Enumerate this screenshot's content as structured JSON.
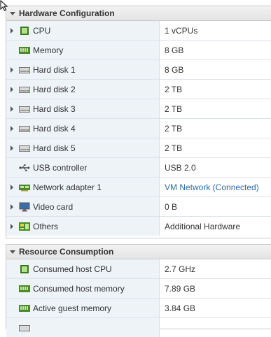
{
  "hardware": {
    "title": "Hardware Configuration",
    "rows": [
      {
        "label": "CPU",
        "value": "1 vCPUs",
        "icon": "cpu-icon"
      },
      {
        "label": "Memory",
        "value": "8 GB",
        "icon": "memory-icon"
      },
      {
        "label": "Hard disk 1",
        "value": "8 GB",
        "icon": "hard-disk-icon"
      },
      {
        "label": "Hard disk 2",
        "value": "2 TB",
        "icon": "hard-disk-icon"
      },
      {
        "label": "Hard disk 3",
        "value": "2 TB",
        "icon": "hard-disk-icon"
      },
      {
        "label": "Hard disk 4",
        "value": "2 TB",
        "icon": "hard-disk-icon"
      },
      {
        "label": "Hard disk 5",
        "value": "2 TB",
        "icon": "hard-disk-icon"
      },
      {
        "label": "USB controller",
        "value": "USB 2.0",
        "icon": "usb-icon"
      },
      {
        "label": "Network adapter 1",
        "value": "VM Network  (Connected)",
        "icon": "network-adapter-icon"
      },
      {
        "label": "Video card",
        "value": "0 B",
        "icon": "monitor-icon"
      },
      {
        "label": "Others",
        "value": "Additional Hardware",
        "icon": "others-icon"
      }
    ]
  },
  "resource": {
    "title": "Resource Consumption",
    "rows": [
      {
        "label": "Consumed host CPU",
        "value": "2.7 GHz",
        "icon": "cpu-icon"
      },
      {
        "label": "Consumed host memory",
        "value": "7.89 GB",
        "icon": "memory-icon"
      },
      {
        "label": "Active guest memory",
        "value": "3.84 GB",
        "icon": "memory-icon"
      },
      {
        "label": "",
        "value": "",
        "icon": "storage-icon"
      }
    ]
  },
  "colors": {
    "header_bg": "#e8e8e8",
    "name_cell_bg": "#eef3f8",
    "link": "#2b6aa8",
    "chip_green": "#4a8a2a"
  }
}
